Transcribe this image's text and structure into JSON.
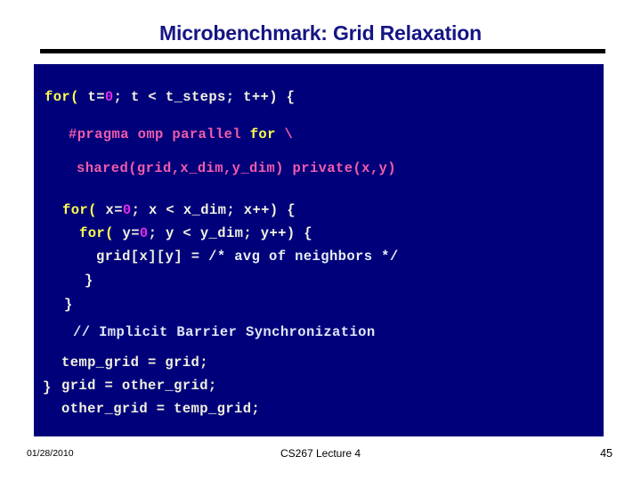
{
  "slide": {
    "title": "Microbenchmark: Grid Relaxation",
    "title_color": "#151585",
    "rule_color": "#000000",
    "panel_color": "#00007b"
  },
  "palette": {
    "keyword": "#ffff4d",
    "number": "#e62ee6",
    "pragma": "#f25caa",
    "plain": "#f2f2e0",
    "comment": "#dfe7f5",
    "background": "#00007b"
  },
  "code": {
    "line1": {
      "kw": "for(",
      "plain_a": " t=",
      "num": "0",
      "plain_b": "; t < t_steps; t++) {"
    },
    "line2": {
      "pragma": "#pragma omp parallel ",
      "kw": "for",
      "cont": " \\"
    },
    "line3": {
      "clauses": "shared(grid,x_dim,y_dim) private(x,y)"
    },
    "line4": {
      "kw": "for(",
      "plain_a": " x=",
      "num": "0",
      "plain_b": "; x < x_dim; x++) {"
    },
    "line5": {
      "kw": "for(",
      "plain_a": " y=",
      "num": "0",
      "plain_b": "; y < y_dim; y++) {"
    },
    "line6": {
      "plain": "grid[x][y] = ",
      "comment": "/* avg of neighbors */"
    },
    "line7": {
      "brace": "}"
    },
    "line8": {
      "brace": "}"
    },
    "line9": {
      "comment": "// Implicit Barrier Synchronization"
    },
    "line10": {
      "plain": "temp_grid = grid;"
    },
    "line11": {
      "plain": "grid = other_grid;"
    },
    "line12": {
      "plain": "other_grid = temp_grid;"
    },
    "line13": {
      "brace": "}"
    }
  },
  "footer": {
    "date": "01/28/2010",
    "center": "CS267 Lecture 4",
    "page": "45"
  }
}
